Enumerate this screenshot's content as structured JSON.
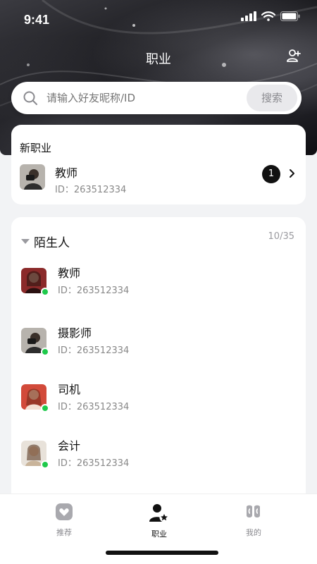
{
  "status_bar": {
    "time": "9:41"
  },
  "header": {
    "title": "职业",
    "add_friend_icon": "add-user-icon"
  },
  "search": {
    "placeholder": "请输入好友昵称/ID",
    "button_label": "搜索"
  },
  "new_section": {
    "title": "新职业",
    "item": {
      "name": "教师",
      "id": "ID：263512334",
      "badge": "1"
    }
  },
  "strangers": {
    "group_name": "陌生人",
    "count": "10/35",
    "items": [
      {
        "name": "教师",
        "id": "ID：263512334",
        "avatar_color": "#8b2a2a",
        "online": true
      },
      {
        "name": "摄影师",
        "id": "ID：263512334",
        "avatar_color": "#6b6b6b",
        "online": true
      },
      {
        "name": "司机",
        "id": "ID：263512334",
        "avatar_color": "#d24a3a",
        "online": true
      },
      {
        "name": "会计",
        "id": "ID：263512334",
        "avatar_color": "#c9b49a",
        "online": true
      }
    ]
  },
  "tabbar": {
    "tabs": [
      {
        "label": "推荐",
        "icon": "heart-icon",
        "active": false
      },
      {
        "label": "职业",
        "icon": "user-star-icon",
        "active": true
      },
      {
        "label": "我的",
        "icon": "quote-icon",
        "active": false
      }
    ]
  },
  "colors": {
    "online": "#1ec94b",
    "accent": "#111111"
  }
}
